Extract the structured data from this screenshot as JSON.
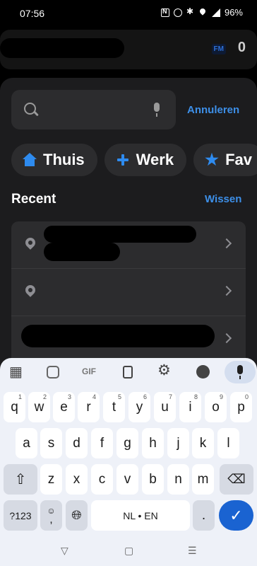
{
  "status_bar": {
    "time": "07:56",
    "battery": "96%"
  },
  "topbar": {
    "badge": "FM",
    "count": "0"
  },
  "search": {
    "placeholder": "",
    "cancel_label": "Annuleren"
  },
  "shortcuts": [
    {
      "label": "Thuis",
      "icon": "home-icon"
    },
    {
      "label": "Werk",
      "icon": "plus-icon"
    },
    {
      "label": "Fav",
      "icon": "star-icon"
    }
  ],
  "recent": {
    "title": "Recent",
    "clear_label": "Wissen"
  },
  "keyboard": {
    "toolbar": {
      "gif_label": "GIF"
    },
    "row1": [
      {
        "k": "q",
        "h": "1"
      },
      {
        "k": "w",
        "h": "2"
      },
      {
        "k": "e",
        "h": "3"
      },
      {
        "k": "r",
        "h": "4"
      },
      {
        "k": "t",
        "h": "5"
      },
      {
        "k": "y",
        "h": "6"
      },
      {
        "k": "u",
        "h": "7"
      },
      {
        "k": "i",
        "h": "8"
      },
      {
        "k": "o",
        "h": "9"
      },
      {
        "k": "p",
        "h": "0"
      }
    ],
    "row2": [
      "a",
      "s",
      "d",
      "f",
      "g",
      "h",
      "j",
      "k",
      "l"
    ],
    "row3": [
      "z",
      "x",
      "c",
      "v",
      "b",
      "n",
      "m"
    ],
    "symbols_label": "?123",
    "emoji_label": "☺",
    "comma_label": ",",
    "space_label": "NL • EN",
    "period_label": "."
  },
  "navbar": {
    "back": "▽",
    "home": "▢",
    "recents": "☰"
  },
  "colors": {
    "accent": "#3d8fe8",
    "chip_icon": "#2e8bef",
    "enter": "#1a63d1"
  }
}
